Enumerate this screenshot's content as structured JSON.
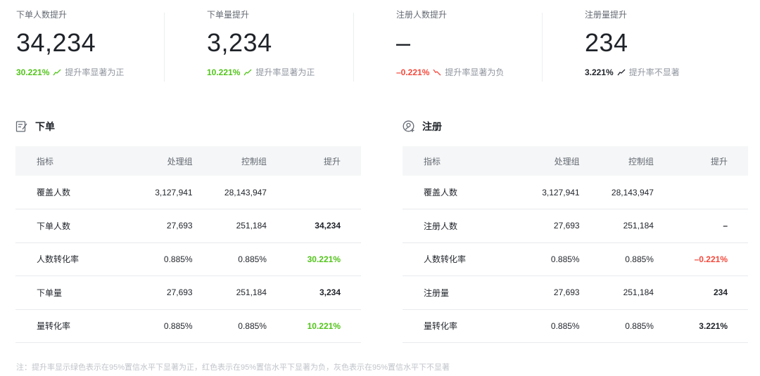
{
  "cards": [
    {
      "label": "下单人数提升",
      "value": "34,234",
      "pct": "30.221%",
      "trend": "up",
      "status": "pos",
      "desc": "提升率显著为正"
    },
    {
      "label": "下单量提升",
      "value": "3,234",
      "pct": "10.221%",
      "trend": "up",
      "status": "pos",
      "desc": "提升率显著为正"
    },
    {
      "label": "注册人数提升",
      "value": "–",
      "pct": "–0.221%",
      "trend": "down",
      "status": "neg",
      "desc": "提升率显著为负"
    },
    {
      "label": "注册量提升",
      "value": "234",
      "pct": "3.221%",
      "trend": "up",
      "status": "neu",
      "desc": "提升率不显著"
    }
  ],
  "sections": [
    {
      "title": "下单",
      "icon": "order-edit-icon",
      "headers": [
        "指标",
        "处理组",
        "控制组",
        "提升"
      ],
      "rows": [
        {
          "cells": [
            "覆盖人数",
            "3,127,941",
            "28,143,947",
            ""
          ],
          "status": "neu"
        },
        {
          "cells": [
            "下单人数",
            "27,693",
            "251,184",
            "34,234"
          ],
          "status": "neu"
        },
        {
          "cells": [
            "人数转化率",
            "0.885%",
            "0.885%",
            "30.221%"
          ],
          "status": "pos"
        },
        {
          "cells": [
            "下单量",
            "27,693",
            "251,184",
            "3,234"
          ],
          "status": "neu"
        },
        {
          "cells": [
            "量转化率",
            "0.885%",
            "0.885%",
            "10.221%"
          ],
          "status": "pos"
        }
      ]
    },
    {
      "title": "注册",
      "icon": "user-add-icon",
      "headers": [
        "指标",
        "处理组",
        "控制组",
        "提升"
      ],
      "rows": [
        {
          "cells": [
            "覆盖人数",
            "3,127,941",
            "28,143,947",
            ""
          ],
          "status": "neu"
        },
        {
          "cells": [
            "注册人数",
            "27,693",
            "251,184",
            "–"
          ],
          "status": "neu"
        },
        {
          "cells": [
            "人数转化率",
            "0.885%",
            "0.885%",
            "–0.221%"
          ],
          "status": "neg"
        },
        {
          "cells": [
            "注册量",
            "27,693",
            "251,184",
            "234"
          ],
          "status": "neu"
        },
        {
          "cells": [
            "量转化率",
            "0.885%",
            "0.885%",
            "3.221%"
          ],
          "status": "neu"
        }
      ]
    }
  ],
  "note": "注：提升率显示绿色表示在95%置信水平下显著为正，红色表示在95%置信水平下显著为负，灰色表示在95%置信水平下不显著",
  "colors": {
    "positive": "#52c41a",
    "negative": "#f5483b",
    "neutral": "#1f2329"
  }
}
